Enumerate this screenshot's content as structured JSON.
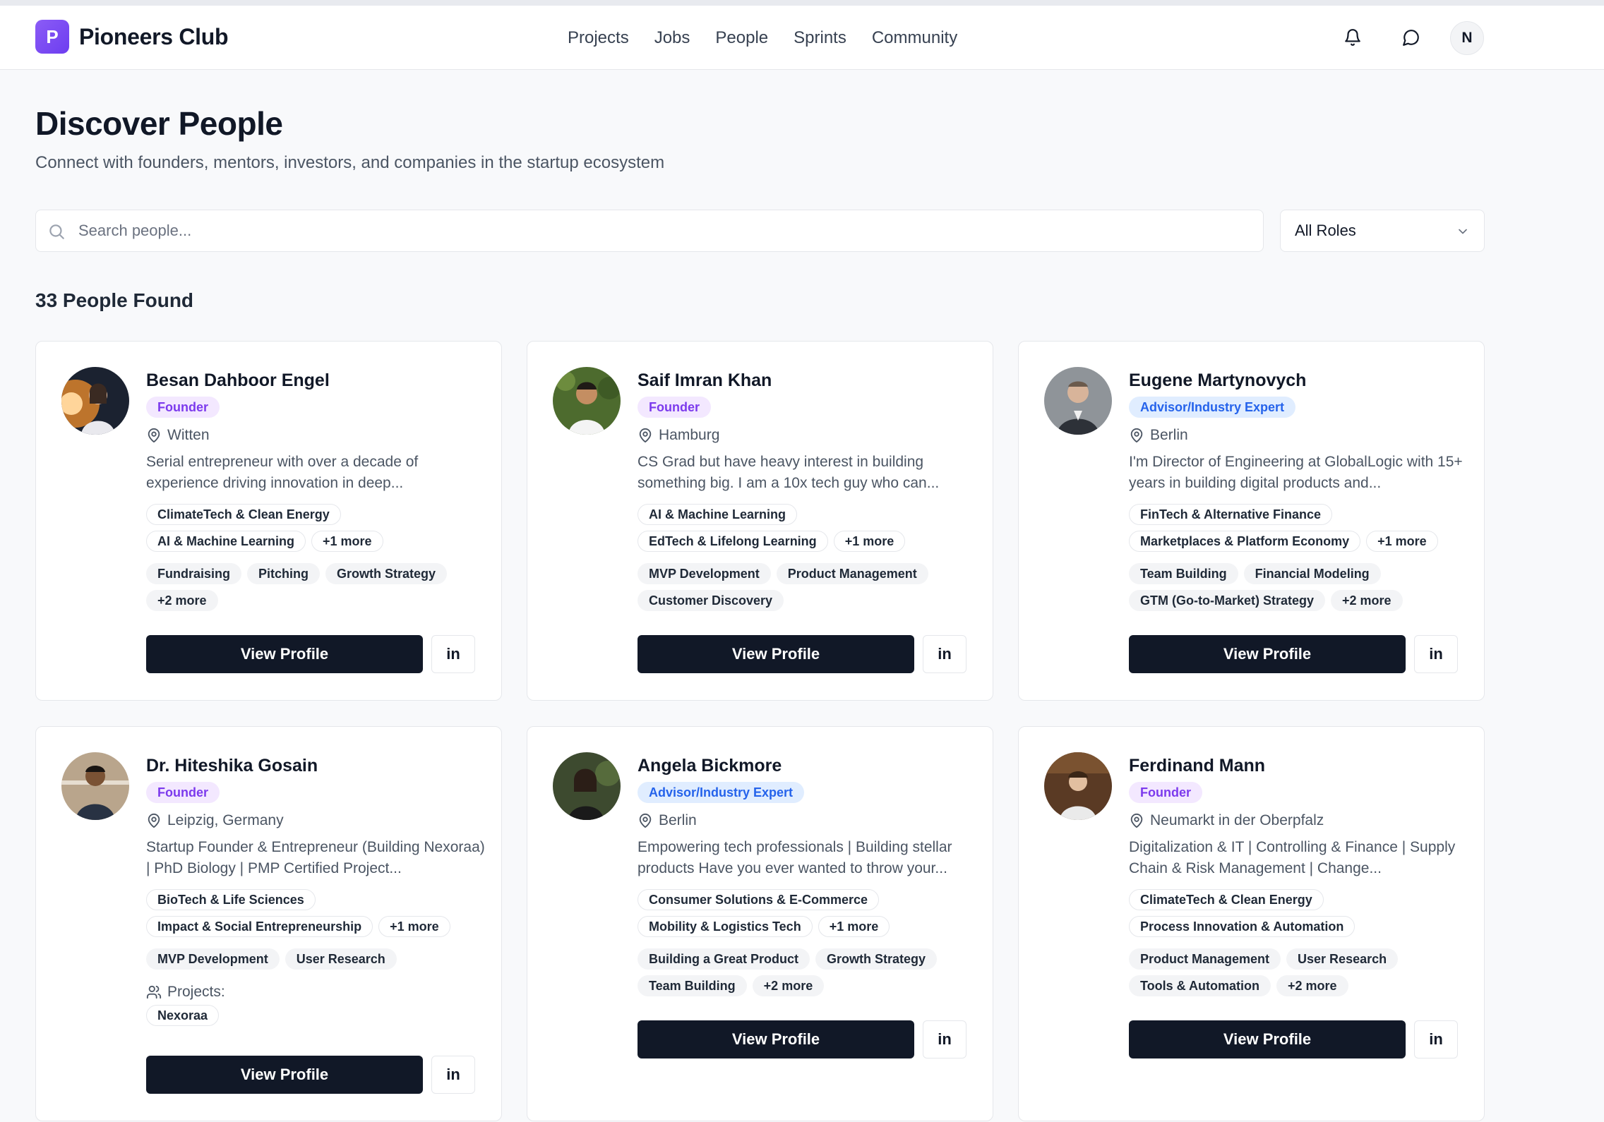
{
  "brand": {
    "logo_letter": "P",
    "name": "Pioneers Club"
  },
  "nav": [
    "Projects",
    "Jobs",
    "People",
    "Sprints",
    "Community"
  ],
  "user": {
    "initial": "N"
  },
  "page": {
    "title": "Discover People",
    "subtitle": "Connect with founders, mentors, investors, and companies in the startup ecosystem"
  },
  "search": {
    "placeholder": "Search people..."
  },
  "role_filter": {
    "selected": "All Roles"
  },
  "results": {
    "count_label": "33 People Found"
  },
  "cards": [
    {
      "name": "Besan Dahboor Engel",
      "role": "Founder",
      "location": "Witten",
      "bio": "Serial entrepreneur with over a decade of experience driving innovation in deep...",
      "industries": [
        "ClimateTech & Clean Energy",
        "AI & Machine Learning",
        "+1 more"
      ],
      "skills": [
        "Fundraising",
        "Pitching",
        "Growth Strategy",
        "+2 more"
      ],
      "view_label": "View Profile",
      "linkedin_label": "in"
    },
    {
      "name": "Saif Imran Khan",
      "role": "Founder",
      "location": "Hamburg",
      "bio": "CS Grad but have heavy interest in building something big. I am a 10x tech guy who can...",
      "industries": [
        "AI & Machine Learning",
        "EdTech & Lifelong Learning",
        "+1 more"
      ],
      "skills": [
        "MVP Development",
        "Product Management",
        "Customer Discovery"
      ],
      "view_label": "View Profile",
      "linkedin_label": "in"
    },
    {
      "name": "Eugene Martynovych",
      "role": "Advisor/Industry Expert",
      "location": "Berlin",
      "bio": "I'm Director of Engineering at GlobalLogic with 15+ years in building digital products and...",
      "industries": [
        "FinTech & Alternative Finance",
        "Marketplaces & Platform Economy",
        "+1 more"
      ],
      "skills": [
        "Team Building",
        "Financial Modeling",
        "GTM (Go-to-Market) Strategy",
        "+2 more"
      ],
      "view_label": "View Profile",
      "linkedin_label": "in"
    },
    {
      "name": "Dr. Hiteshika Gosain",
      "role": "Founder",
      "location": "Leipzig, Germany",
      "bio": "Startup Founder & Entrepreneur (Building Nexoraa) | PhD Biology | PMP Certified Project...",
      "industries": [
        "BioTech & Life Sciences",
        "Impact & Social Entrepreneurship",
        "+1 more"
      ],
      "skills": [
        "MVP Development",
        "User Research"
      ],
      "projects_label": "Projects:",
      "projects": [
        "Nexoraa"
      ],
      "view_label": "View Profile",
      "linkedin_label": "in"
    },
    {
      "name": "Angela Bickmore",
      "role": "Advisor/Industry Expert",
      "location": "Berlin",
      "bio": "Empowering tech professionals | Building stellar products Have you ever wanted to throw your...",
      "industries": [
        "Consumer Solutions & E-Commerce",
        "Mobility & Logistics Tech",
        "+1 more"
      ],
      "skills": [
        "Building a Great Product",
        "Growth Strategy",
        "Team Building",
        "+2 more"
      ],
      "view_label": "View Profile",
      "linkedin_label": "in"
    },
    {
      "name": "Ferdinand Mann",
      "role": "Founder",
      "location": "Neumarkt in der Oberpfalz",
      "bio": "Digitalization & IT | Controlling & Finance | Supply Chain & Risk Management | Change...",
      "industries": [
        "ClimateTech & Clean Energy",
        "Process Innovation & Automation"
      ],
      "skills": [
        "Product Management",
        "User Research",
        "Tools & Automation",
        "+2 more"
      ],
      "view_label": "View Profile",
      "linkedin_label": "in"
    }
  ],
  "icons": {
    "notifications": "bell-icon",
    "messages": "message-icon",
    "search": "search-icon",
    "dropdown": "chevron-down-icon",
    "location": "map-pin-icon",
    "projects": "users-icon",
    "linkedin": "linkedin-icon"
  },
  "colors": {
    "brand": "#7c3aed",
    "primary_button": "#111827",
    "founder_badge": "#f3e8ff",
    "advisor_badge": "#e0edff"
  }
}
